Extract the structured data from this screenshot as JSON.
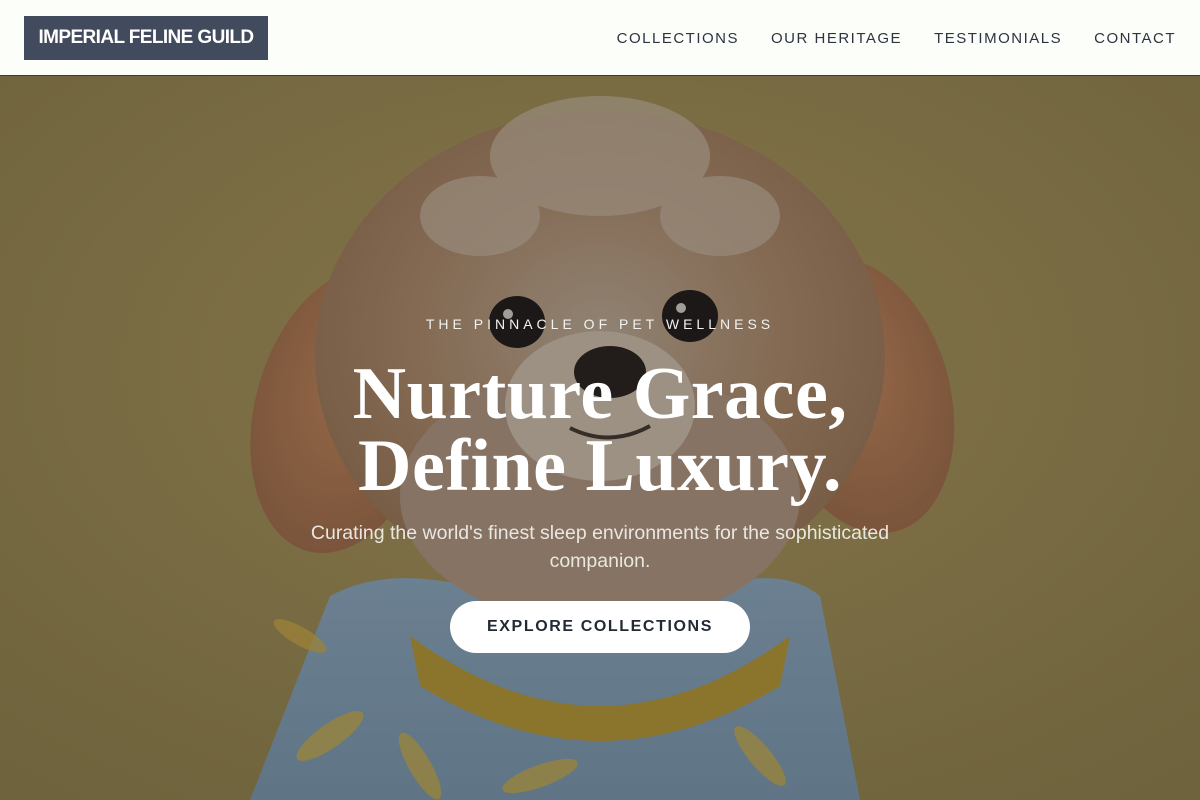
{
  "brand": {
    "logo_text": "IMPERIAL FELINE GUILD"
  },
  "nav": {
    "items": [
      {
        "label": "COLLECTIONS"
      },
      {
        "label": "OUR HERITAGE"
      },
      {
        "label": "TESTIMONIALS"
      },
      {
        "label": "CONTACT"
      }
    ]
  },
  "hero": {
    "eyebrow": "THE PINNACLE OF PET WELLNESS",
    "headline_line1": "Nurture Grace,",
    "headline_line2": "Define Luxury.",
    "subtitle": "Curating the world's finest sleep environments for the sophisticated companion.",
    "cta_label": "EXPLORE COLLECTIONS",
    "background_image": "small fluffy dog wearing blue banana-print shirt against mustard yellow backdrop"
  },
  "colors": {
    "logo_bg": "#424b5d",
    "header_bg": "#fcfefa",
    "hero_backdrop": "#8c7a48",
    "cta_bg": "#ffffff",
    "cta_text": "#222a36"
  }
}
